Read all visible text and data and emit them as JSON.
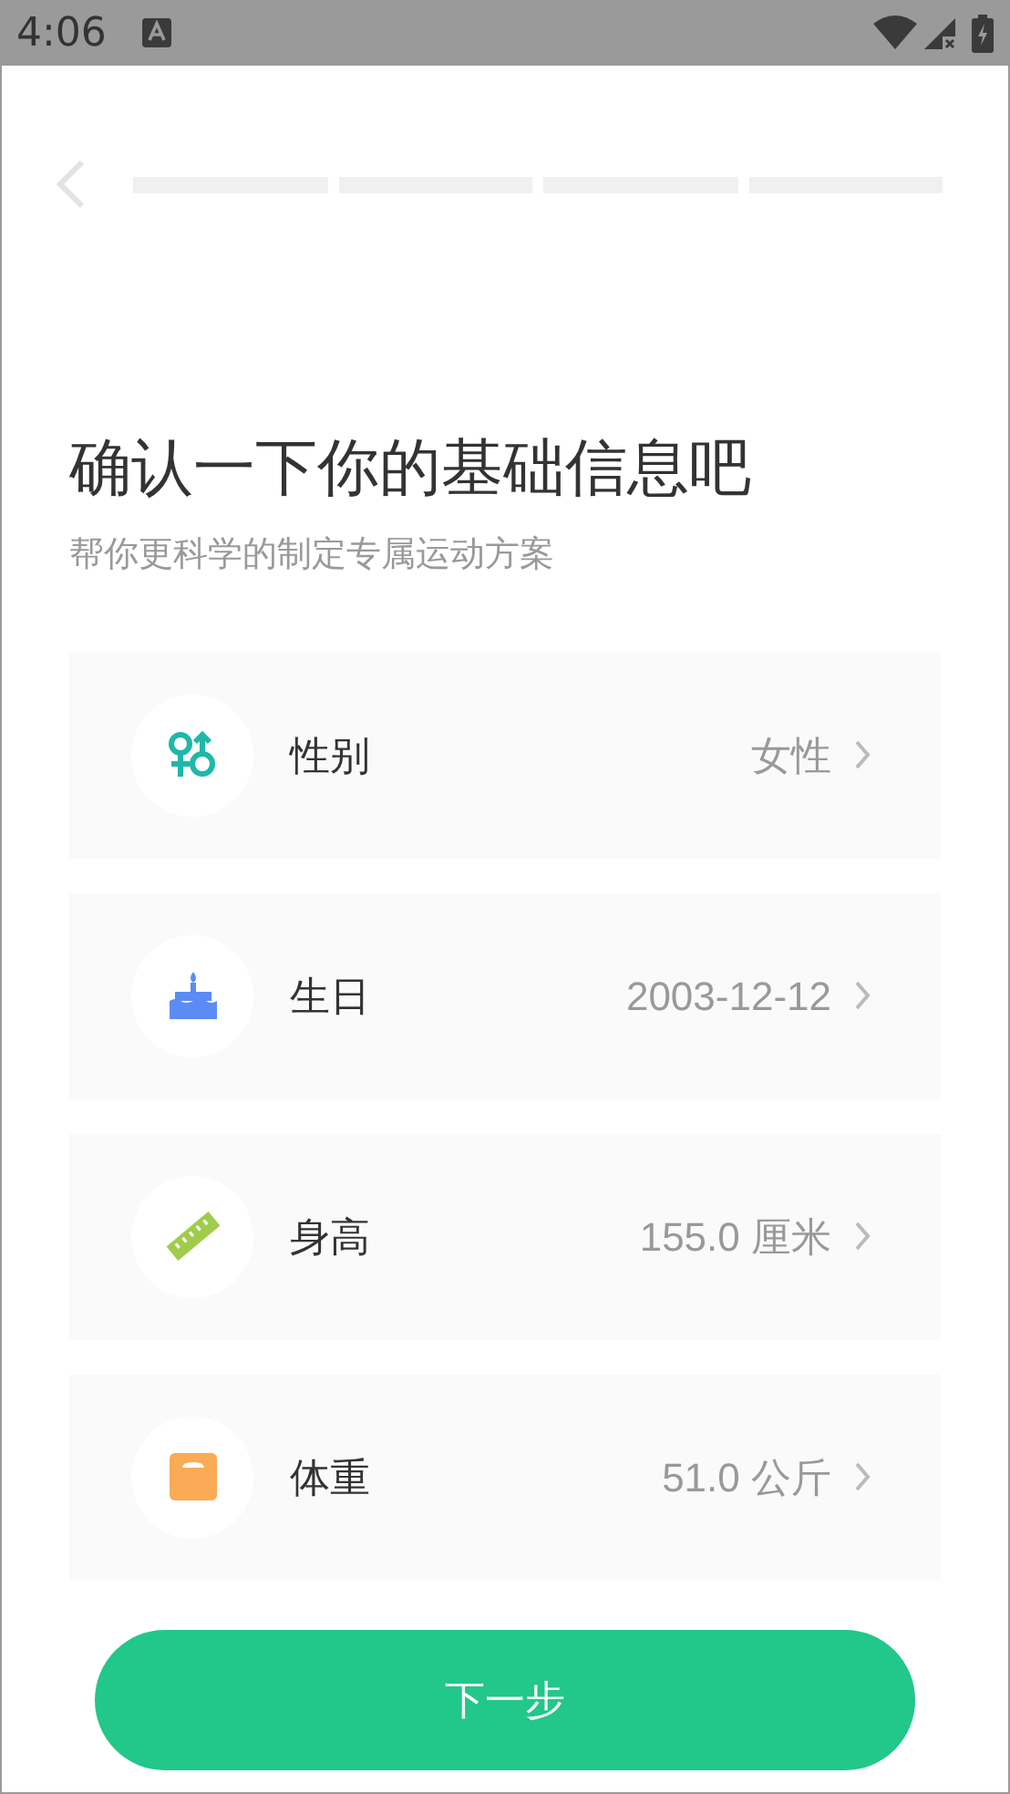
{
  "status_bar": {
    "time": "4:06"
  },
  "progress": [
    {
      "filled": false
    },
    {
      "filled": false
    },
    {
      "filled": false
    },
    {
      "filled": false
    }
  ],
  "title": "确认一下你的基础信息吧",
  "subtitle": "帮你更科学的制定专属运动方案",
  "items": [
    {
      "kind": "gender",
      "label": "性别",
      "value": "女性"
    },
    {
      "kind": "birthday",
      "label": "生日",
      "value": "2003-12-12"
    },
    {
      "kind": "height",
      "label": "身高",
      "value": "155.0 厘米"
    },
    {
      "kind": "weight",
      "label": "体重",
      "value": "51.0 公斤"
    }
  ],
  "next_button": "下一步"
}
